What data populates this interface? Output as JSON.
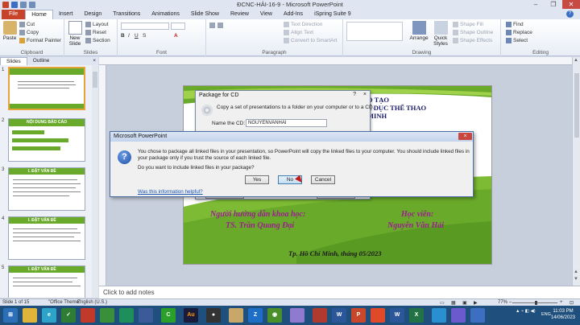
{
  "window": {
    "title": "ĐCNC-HẢI-16-9 - Microsoft PowerPoint"
  },
  "ribbon": {
    "tabs": [
      "File",
      "Home",
      "Insert",
      "Design",
      "Transitions",
      "Animations",
      "Slide Show",
      "Review",
      "View",
      "Add-Ins",
      "iSpring Suite 9"
    ],
    "active_tab": "Home",
    "clipboard": {
      "paste": "Paste",
      "cut": "Cut",
      "copy": "Copy",
      "format_painter": "Format Painter",
      "label": "Clipboard"
    },
    "slides": {
      "new_slide": "New Slide",
      "layout": "Layout",
      "reset": "Reset",
      "section": "Section",
      "label": "Slides"
    },
    "font": {
      "label": "Font"
    },
    "paragraph": {
      "text_direction": "Text Direction",
      "align_text": "Align Text",
      "convert_smartart": "Convert to SmartArt",
      "label": "Paragraph"
    },
    "drawing": {
      "arrange": "Arrange",
      "quick_styles": "Quick Styles",
      "shape_fill": "Shape Fill",
      "shape_outline": "Shape Outline",
      "shape_effects": "Shape Effects",
      "label": "Drawing"
    },
    "editing": {
      "find": "Find",
      "replace": "Replace",
      "select": "Select",
      "label": "Editing"
    }
  },
  "pane": {
    "tabs": [
      "Slides",
      "Outline"
    ],
    "close": "×"
  },
  "thumbnails": [
    {
      "num": "1",
      "title": ""
    },
    {
      "num": "2",
      "title": "NỘI DUNG BÁO CÁO"
    },
    {
      "num": "3",
      "title": "I. ĐẶT VẤN ĐỀ"
    },
    {
      "num": "4",
      "title": "I. ĐẶT VẤN ĐỀ"
    },
    {
      "num": "5",
      "title": "I. ĐẶT VẤN ĐỀ"
    }
  ],
  "slide": {
    "title_line1": "O TẠO",
    "title_line2": "Ể DỤC THỂ THAO",
    "title_line3": "MINH",
    "advisor_label": "Người hướng dẫn khoa học:",
    "advisor_name": "TS. Trần Quang Đại",
    "student_label": "Học viên:",
    "student_name": "Nguyễn Văn Hải",
    "footer": "Tp. Hồ Chí Minh, tháng 05/2023"
  },
  "notes": {
    "placeholder": "Click to add notes"
  },
  "package_dialog": {
    "title": "Package for CD",
    "help": "?",
    "close": "×",
    "description": "Copy a set of presentations to a folder on your computer or to a CD.",
    "name_label": "Name the CD:",
    "name_value": "NGUYENVANHAI"
  },
  "message_dialog": {
    "caption": "Microsoft PowerPoint",
    "close": "×",
    "message": "You chose to package all linked files in your presentation, so PowerPoint will copy the linked files to your computer. You should include linked files in your package only if you trust the source of each linked file.",
    "question": "Do you want to include linked files in your package?",
    "yes": "Yes",
    "no": "No",
    "cancel": "Cancel",
    "help_link": "Was this information helpful?"
  },
  "statusbar": {
    "slide_info": "Slide 1 of 15",
    "theme": "\"Office Theme\"",
    "language": "English (U.S.)",
    "zoom": "77%"
  },
  "taskbar": {
    "time": "11:03 PM",
    "date": "14/06/2023",
    "lang": "ENG"
  },
  "colors": {
    "file_tab": "#c7442b",
    "slide_green": "#6aaa2a",
    "thumb_title": "#b01e1e",
    "advisor_text": "#9b1f8f",
    "taskbar": "#1f4f7c"
  }
}
